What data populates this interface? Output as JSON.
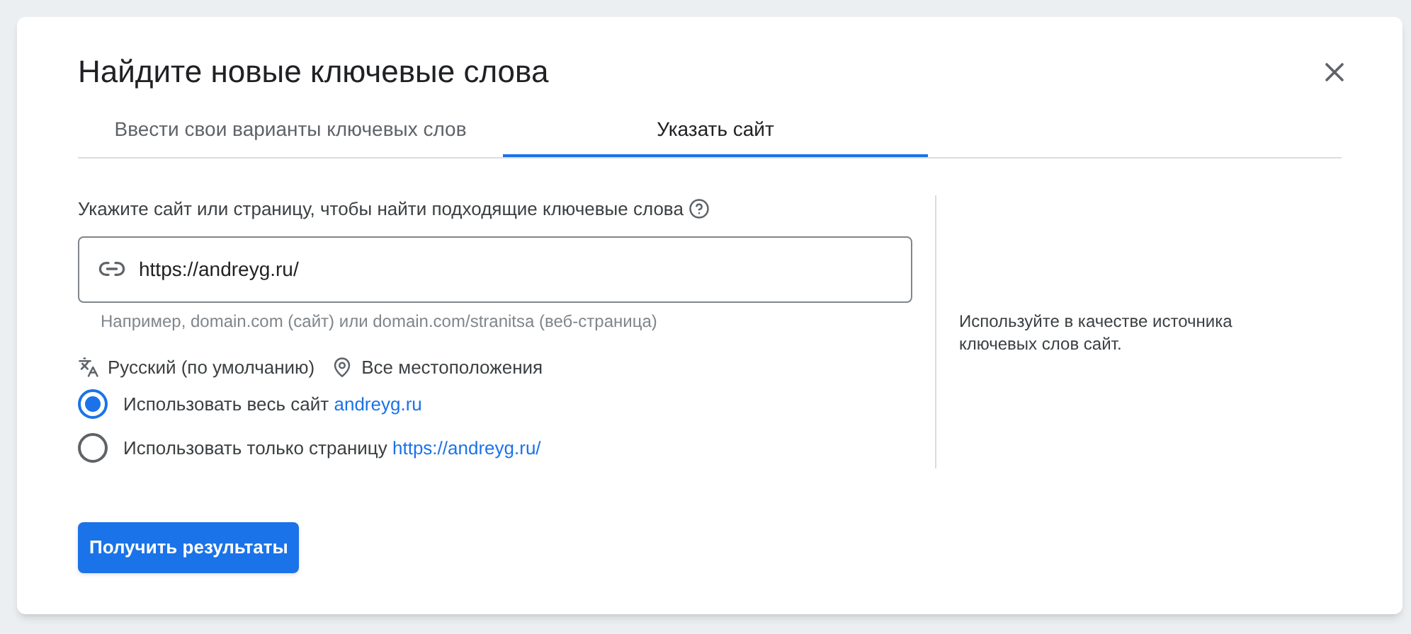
{
  "dialog": {
    "title": "Найдите новые ключевые слова"
  },
  "tabs": [
    {
      "label": "Ввести свои варианты ключевых слов",
      "selected": false
    },
    {
      "label": "Указать сайт",
      "selected": true
    }
  ],
  "form": {
    "label": "Укажите сайт или страницу, чтобы найти подходящие ключевые слова",
    "url_field": {
      "value": "https://andreyg.ru/"
    },
    "hint": "Например, domain.com (сайт) или domain.com/stranitsa (веб-страница)",
    "language": "Русский (по умолчанию)",
    "location": "Все местоположения",
    "options": [
      {
        "label": "Использовать весь сайт",
        "link": "andreyg.ru",
        "selected": true
      },
      {
        "label": "Использовать только страницу",
        "link": "https://andreyg.ru/",
        "selected": false
      }
    ]
  },
  "side_note": "Используйте в качестве источника ключевых слов сайт.",
  "submit_button": "Получить результаты"
}
